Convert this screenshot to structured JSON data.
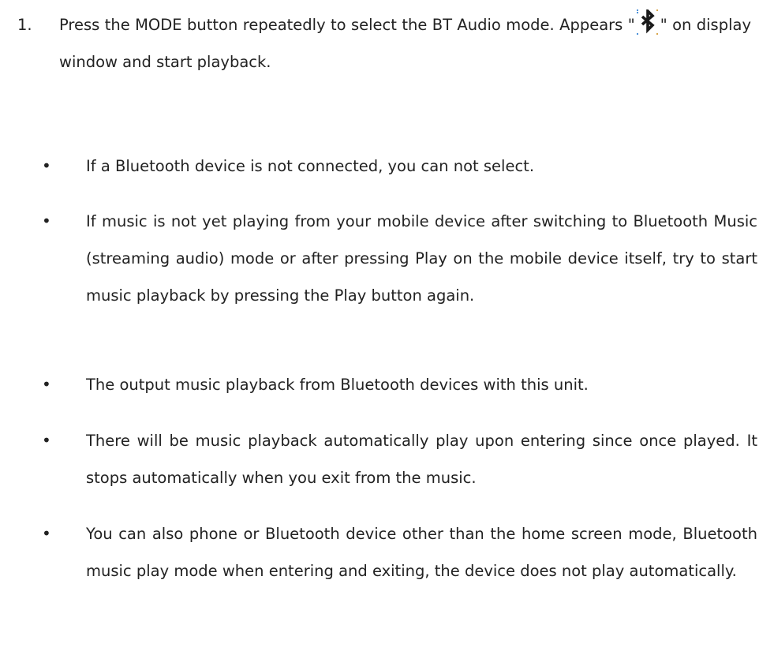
{
  "step": {
    "number": "1.",
    "text_before_icon": "Press the MODE button repeatedly to select the BT Audio mode. Appears \"",
    "icon": "bluetooth-icon",
    "text_after_icon": "\" on display window and start playback."
  },
  "bullets": [
    {
      "marker": "•",
      "text": "If a Bluetooth device is not connected, you can not select."
    },
    {
      "marker": "•",
      "text": "If music is not yet playing from your mobile device after switching to Bluetooth Music (streaming audio) mode or after pressing Play on the mobile device itself, try to start music playback by pressing the Play button again."
    },
    {
      "marker": "•",
      "text": "The output music playback from Bluetooth devices with this unit."
    },
    {
      "marker": "•",
      "text": "There will be music playback automatically play upon entering since once played. It stops automatically when you exit from the music."
    },
    {
      "marker": "•",
      "text": "You can also phone or Bluetooth device other than the home screen mode, Bluetooth music play mode when entering and exiting, the device does not play automatically."
    }
  ],
  "colors": {
    "text": "#222222",
    "background": "#ffffff"
  }
}
